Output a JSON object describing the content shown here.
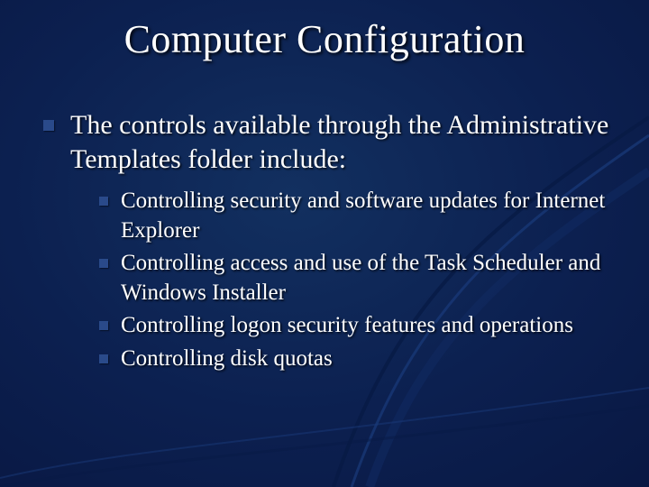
{
  "title": "Computer Configuration",
  "main_bullet": "The controls available through the Administrative Templates folder include:",
  "sub": {
    "b0": "Controlling security and software updates for Internet Explorer",
    "b1": "Controlling access and use of the Task Scheduler and Windows Installer",
    "b2": "Controlling logon security features and operations",
    "b3": "Controlling disk quotas"
  }
}
